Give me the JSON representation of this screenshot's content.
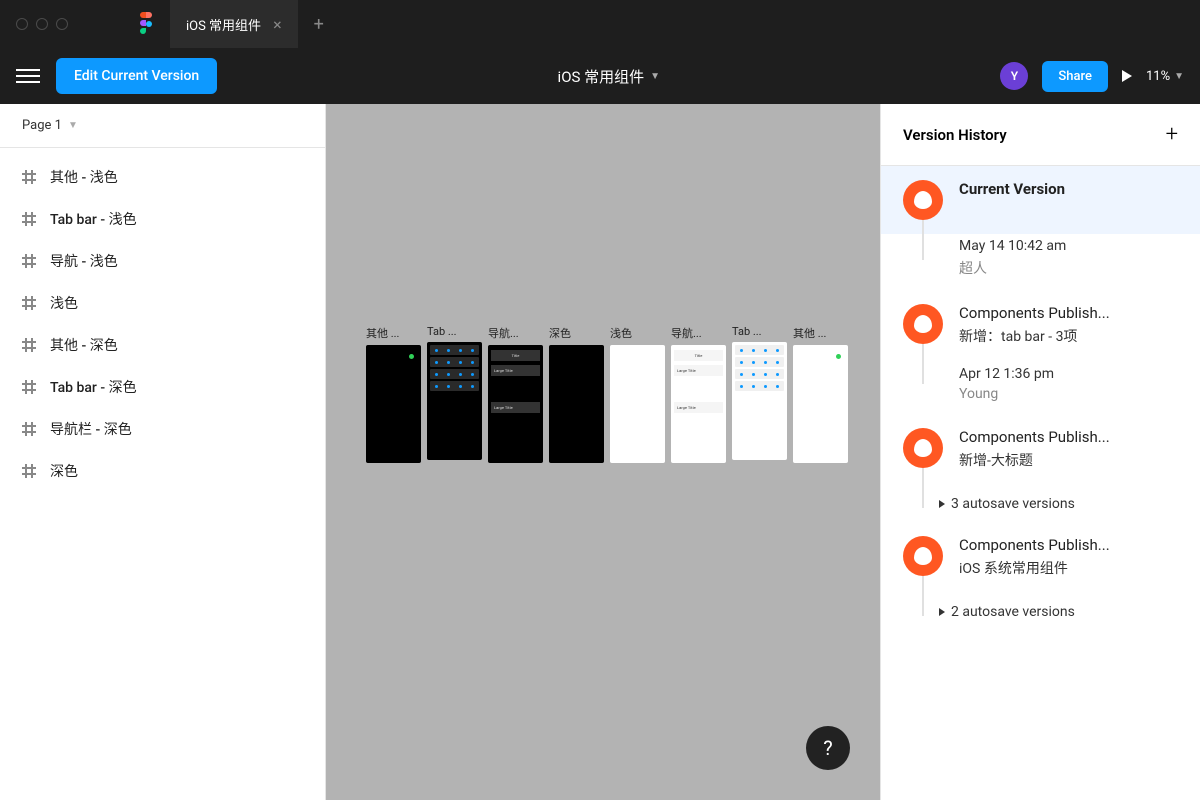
{
  "tab": {
    "title": "iOS 常用组件"
  },
  "toolbar": {
    "edit_label": "Edit Current Version",
    "doc_title": "iOS 常用组件",
    "avatar_initial": "Y",
    "share_label": "Share",
    "zoom": "11%"
  },
  "page_selector": "Page 1",
  "layers": [
    {
      "name": "其他 - 浅色"
    },
    {
      "name": "Tab bar - 浅色"
    },
    {
      "name": "导航 - 浅色"
    },
    {
      "name": "浅色"
    },
    {
      "name": "其他 - 深色"
    },
    {
      "name": "Tab bar - 深色"
    },
    {
      "name": "导航栏 - 深色"
    },
    {
      "name": "深色"
    }
  ],
  "canvas_frames": [
    {
      "label": "其他 ...",
      "variant": "dark-other"
    },
    {
      "label": "Tab ...",
      "variant": "dark-tab"
    },
    {
      "label": "导航...",
      "variant": "dark-nav"
    },
    {
      "label": "深色",
      "variant": "dark-plain"
    },
    {
      "label": "浅色",
      "variant": "light-plain"
    },
    {
      "label": "导航...",
      "variant": "light-nav"
    },
    {
      "label": "Tab ...",
      "variant": "light-tab"
    },
    {
      "label": "其他 ...",
      "variant": "light-other"
    }
  ],
  "version_panel": {
    "title": "Version History",
    "entries": [
      {
        "kind": "current",
        "title": "Current Version"
      },
      {
        "kind": "meta",
        "time": "May 14 10:42 am",
        "author": "超人"
      },
      {
        "kind": "named",
        "title": "Components Publish...",
        "sub": "新增：tab bar - 3项"
      },
      {
        "kind": "meta",
        "time": "Apr 12 1:36 pm",
        "author": "Young"
      },
      {
        "kind": "named",
        "title": "Components Publish...",
        "sub": "新增-大标题"
      },
      {
        "kind": "autosave",
        "text": "3 autosave versions"
      },
      {
        "kind": "named",
        "title": "Components Publish...",
        "sub": "iOS 系统常用组件"
      },
      {
        "kind": "autosave",
        "text": "2 autosave versions"
      }
    ]
  },
  "frame_thumb_text": {
    "large_title": "Large Title",
    "title": "Title"
  }
}
